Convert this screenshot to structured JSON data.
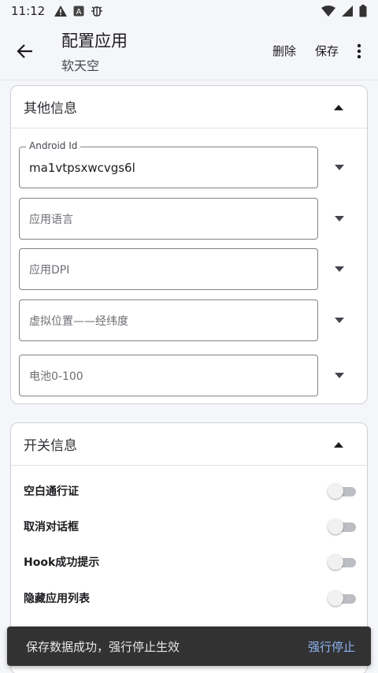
{
  "status_bar": {
    "time": "11:12",
    "icons": [
      "alert-icon",
      "app-notification-icon",
      "debug-icon"
    ],
    "right_icons": [
      "wifi-icon",
      "signal-icon",
      "battery-icon"
    ]
  },
  "app_bar": {
    "title": "配置应用",
    "subtitle": "软天空",
    "delete_label": "删除",
    "save_label": "保存"
  },
  "other_info": {
    "title": "其他信息",
    "fields": [
      {
        "label": "Android Id",
        "value": "ma1vtpsxwcvgs6l",
        "placeholder": ""
      },
      {
        "label": "",
        "value": "",
        "placeholder": "应用语言"
      },
      {
        "label": "",
        "value": "",
        "placeholder": "应用DPI"
      },
      {
        "label": "",
        "value": "",
        "placeholder": "虚拟位置——经纬度"
      },
      {
        "label": "",
        "value": "",
        "placeholder": "电池0-100"
      }
    ]
  },
  "switch_info": {
    "title": "开关信息",
    "switches": [
      {
        "label": "空白通行证",
        "on": false
      },
      {
        "label": "取消对话框",
        "on": false
      },
      {
        "label": "Hook成功提示",
        "on": false
      },
      {
        "label": "隐藏应用列表",
        "on": false
      }
    ]
  },
  "snackbar": {
    "message": "保存数据成功，强行停止生效",
    "action": "强行停止"
  },
  "colors": {
    "background": "#f5f6fa",
    "card_border": "#cfd0d6",
    "snackbar": "#323232",
    "snackbar_action": "#8fb4f5",
    "switch_track_off": "#bdbec3"
  }
}
